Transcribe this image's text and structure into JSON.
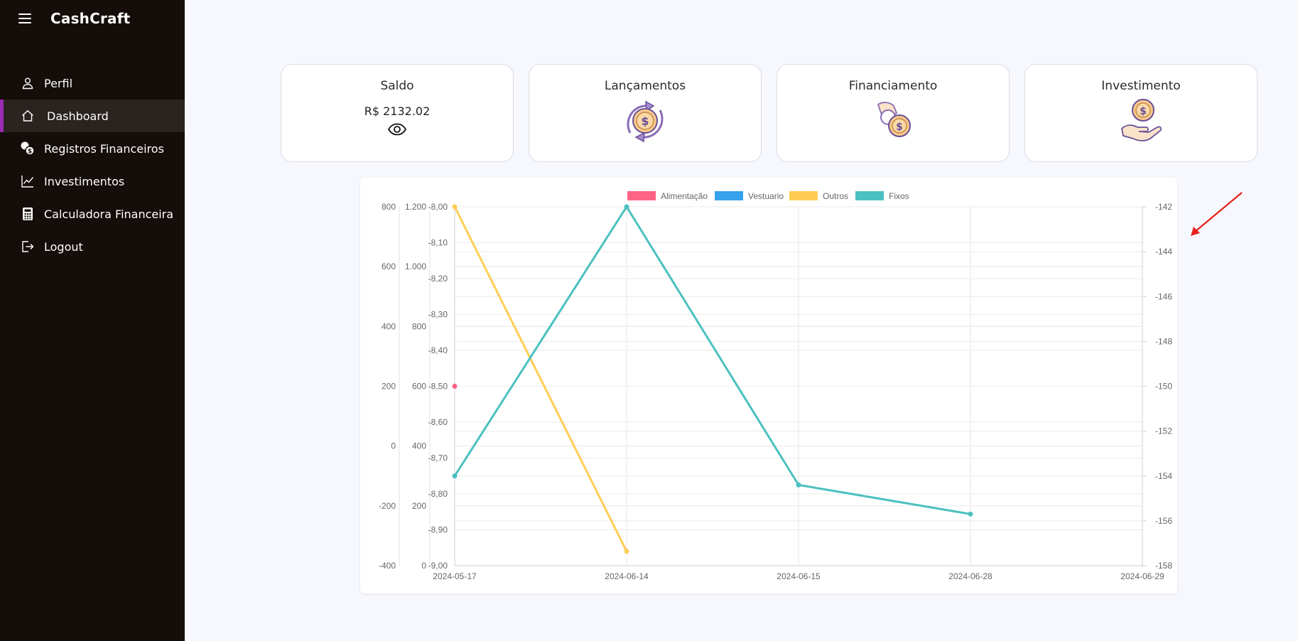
{
  "app": {
    "name": "CashCraft"
  },
  "sidebar": {
    "items": [
      {
        "label": "Perfil",
        "icon": "user-icon"
      },
      {
        "label": "Dashboard",
        "icon": "home-icon",
        "active": true
      },
      {
        "label": "Registros Financeiros",
        "icon": "coins-icon"
      },
      {
        "label": "Investimentos",
        "icon": "line-chart-icon"
      },
      {
        "label": "Calculadora Financeira",
        "icon": "calculator-icon"
      },
      {
        "label": "Logout",
        "icon": "logout-icon"
      }
    ]
  },
  "cards": [
    {
      "title": "Saldo",
      "value": "R$ 2132.02",
      "icon": "eye-icon"
    },
    {
      "title": "Lançamentos",
      "icon": "coin-exchange-icon"
    },
    {
      "title": "Financiamento",
      "icon": "hand-coins-icon"
    },
    {
      "title": "Investimento",
      "icon": "hand-coin-icon"
    }
  ],
  "chart_data": {
    "type": "line",
    "categories": [
      "2024-05-17",
      "2024-06-14",
      "2024-06-15",
      "2024-06-28",
      "2024-06-29"
    ],
    "legend_position": "top",
    "grid": true,
    "axes": {
      "y_alimentacao": {
        "ticks": [
          "800",
          "600",
          "400",
          "200",
          "0",
          "-200",
          "-400"
        ],
        "range": [
          -400,
          800
        ]
      },
      "y_vestuario": {
        "ticks": [
          "1.200",
          "1.000",
          "800",
          "600",
          "400",
          "200",
          "0"
        ],
        "range": [
          0,
          1200
        ]
      },
      "y_outros": {
        "ticks": [
          "-8,00",
          "-8,10",
          "-8,20",
          "-8,30",
          "-8,40",
          "-8,50",
          "-8,60",
          "-8,70",
          "-8,80",
          "-8,90",
          "-9,00"
        ],
        "range": [
          -9.0,
          -8.0
        ]
      },
      "y_fixos": {
        "ticks": [
          "-142",
          "-144",
          "-146",
          "-148",
          "-150",
          "-152",
          "-154",
          "-156",
          "-158"
        ],
        "range": [
          -158,
          -142
        ]
      }
    },
    "series": [
      {
        "name": "Alimentação",
        "color": "#ff6384",
        "axis": "y_alimentacao",
        "values": [
          200,
          null,
          null,
          null,
          null
        ]
      },
      {
        "name": "Vestuario",
        "color": "#36a2eb",
        "axis": "y_vestuario",
        "values": [
          null,
          null,
          null,
          null,
          null
        ]
      },
      {
        "name": "Outros",
        "color": "#ffcd56",
        "axis": "y_outros",
        "values": [
          -8.0,
          -8.96,
          null,
          null,
          null
        ]
      },
      {
        "name": "Fixos",
        "color": "#4bc0c0",
        "axis": "y_fixos",
        "values": [
          -154,
          -142,
          -154.4,
          -155.7,
          null
        ]
      }
    ]
  },
  "annotation": {
    "arrow_color": "#e8211d"
  }
}
